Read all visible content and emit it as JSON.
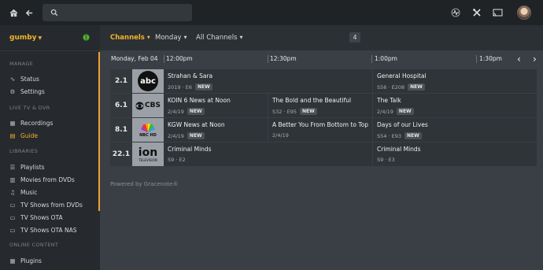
{
  "topbar": {
    "icons": [
      "home-icon",
      "back-arrow-icon",
      "search-icon",
      "activity-icon",
      "tools-icon",
      "cast-icon",
      "avatar"
    ],
    "search": {
      "placeholder": ""
    }
  },
  "sidebar": {
    "user": "gumby",
    "sections": [
      {
        "title": "MANAGE",
        "items": [
          {
            "label": "Status",
            "icon": "pulse-icon"
          },
          {
            "label": "Settings",
            "icon": "gear-icon"
          }
        ]
      },
      {
        "title": "LIVE TV & DVR",
        "items": [
          {
            "label": "Recordings",
            "icon": "calendar-icon"
          },
          {
            "label": "Guide",
            "icon": "grid-icon",
            "active": true
          }
        ]
      },
      {
        "title": "LIBRARIES",
        "items": [
          {
            "label": "Playlists",
            "icon": "list-icon"
          },
          {
            "label": "Movies from DVDs",
            "icon": "film-icon"
          },
          {
            "label": "Music",
            "icon": "music-icon"
          },
          {
            "label": "TV Shows from DVDs",
            "icon": "tv-icon"
          },
          {
            "label": "TV Shows OTA",
            "icon": "tv-icon"
          },
          {
            "label": "TV Shows OTA NAS",
            "icon": "tv-icon"
          }
        ]
      },
      {
        "title": "ONLINE CONTENT",
        "items": [
          {
            "label": "Plugins",
            "icon": "grid-icon"
          }
        ]
      }
    ]
  },
  "filters": {
    "channels": "Channels",
    "day": "Monday",
    "all_channels": "All Channels",
    "count": "4"
  },
  "guide": {
    "date": "Monday, Feb 04",
    "times": [
      "12:00pm",
      "12:30pm",
      "1:00pm",
      "1:30pm"
    ],
    "channels": [
      {
        "number": "2.1",
        "logo": "abc",
        "programs": [
          {
            "title": "Strahan & Sara",
            "meta": "2019 · E6",
            "new": "NEW"
          },
          {
            "title": "General Hospital",
            "meta": "S56 · E208",
            "new": "NEW"
          }
        ]
      },
      {
        "number": "6.1",
        "logo": "CBS",
        "programs": [
          {
            "title": "KOIN 6 News at Noon",
            "meta": "2/4/19",
            "new": "NEW"
          },
          {
            "title": "The Bold and the Beautiful",
            "meta": "S32 · E95",
            "new": "NEW"
          },
          {
            "title": "The Talk",
            "meta": "2/4/19",
            "new": "NEW"
          }
        ]
      },
      {
        "number": "8.1",
        "logo": "NBC HD",
        "programs": [
          {
            "title": "KGW News at Noon",
            "meta": "2/4/19",
            "new": "NEW"
          },
          {
            "title": "A Better You From Bottom to Top",
            "meta": "2/4/19",
            "new": ""
          },
          {
            "title": "Days of our Lives",
            "meta": "S54 · E93",
            "new": "NEW"
          }
        ]
      },
      {
        "number": "22.1",
        "logo": "ion",
        "logo_sub": "TELEVISION",
        "programs": [
          {
            "title": "Criminal Minds",
            "meta": "S9 · E2",
            "new": ""
          },
          {
            "title": "Criminal Minds",
            "meta": "S9 · E3",
            "new": ""
          }
        ]
      }
    ],
    "powered_by": "Powered by Gracenote®"
  },
  "colors": {
    "accent": "#f0b429",
    "sidebar": "#262a2e",
    "topbar": "#1f2326",
    "background": "#3a3f45"
  }
}
